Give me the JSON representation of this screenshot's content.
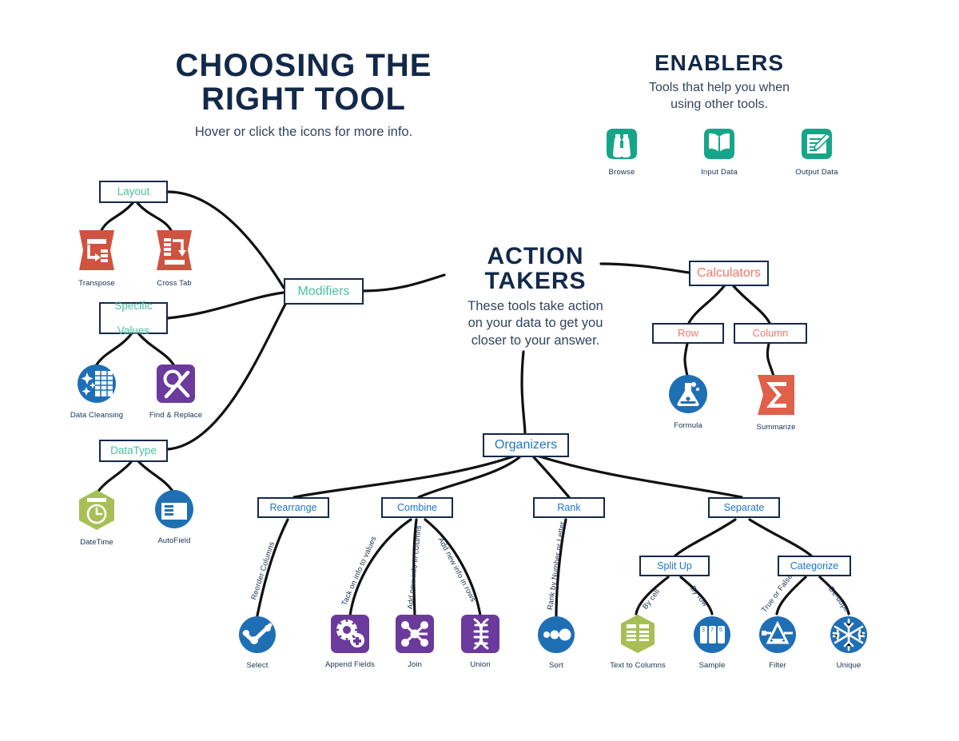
{
  "title": {
    "heading_line1": "CHOOSING THE",
    "heading_line2": "RIGHT TOOL",
    "subtitle": "Hover or click the icons for more info."
  },
  "enablers": {
    "heading": "ENABLERS",
    "subtitle_line1": "Tools that help you when",
    "subtitle_line2": "using other tools.",
    "items": [
      {
        "label": "Browse",
        "icon": "binoculars-icon",
        "color": "#17a589"
      },
      {
        "label": "Input Data",
        "icon": "open-book-icon",
        "color": "#17a589"
      },
      {
        "label": "Output Data",
        "icon": "document-pencil-icon",
        "color": "#17a589"
      }
    ]
  },
  "action_takers": {
    "heading_line1": "ACTION",
    "heading_line2": "TAKERS",
    "subtitle_line1": "These tools take action",
    "subtitle_line2": "on your data to get you",
    "subtitle_line3": "closer to your answer."
  },
  "nodes": {
    "modifiers": "Modifiers",
    "layout": "Layout",
    "specific_values_line1": "Specific",
    "specific_values_line2": "Values",
    "datatype": "DataType",
    "calculators": "Calculators",
    "row": "Row",
    "column": "Column",
    "organizers": "Organizers",
    "rearrange": "Rearrange",
    "combine": "Combine",
    "rank": "Rank",
    "separate": "Separate",
    "split_up": "Split Up",
    "categorize": "Categorize"
  },
  "edge_labels": {
    "reorder_columns": "Reorder Columns",
    "tack_on_info": "Tack on info to values",
    "add_info_columns": "Add new info in columns",
    "add_info_rows": "Add new info in rows",
    "rank_by": "Rank by Number or Letter",
    "by_cell": "By cell",
    "by_row": "By row",
    "true_or_false": "True or False",
    "de_dupe": "De-dupe"
  },
  "tools": [
    {
      "label": "Transpose",
      "icon": "transpose-icon",
      "color": "#cf5340",
      "shape": "wave"
    },
    {
      "label": "Cross Tab",
      "icon": "cross-tab-icon",
      "color": "#cf5340",
      "shape": "wave"
    },
    {
      "label": "Data Cleansing",
      "icon": "data-cleansing-icon",
      "color": "#1f6fb5",
      "shape": "circle"
    },
    {
      "label": "Find & Replace",
      "icon": "find-replace-icon",
      "color": "#6b3a9c",
      "shape": "square"
    },
    {
      "label": "DateTime",
      "icon": "datetime-icon",
      "color": "#a8bf56",
      "shape": "hexagon"
    },
    {
      "label": "AutoField",
      "icon": "autofield-icon",
      "color": "#1f6fb5",
      "shape": "circle"
    },
    {
      "label": "Formula",
      "icon": "formula-flask-icon",
      "color": "#1f6fb5",
      "shape": "circle"
    },
    {
      "label": "Summarize",
      "icon": "summarize-sigma-icon",
      "color": "#e0604a",
      "shape": "square"
    },
    {
      "label": "Select",
      "icon": "select-icon",
      "color": "#1f6fb5",
      "shape": "circle"
    },
    {
      "label": "Append Fields",
      "icon": "append-fields-icon",
      "color": "#6b3a9c",
      "shape": "square"
    },
    {
      "label": "Join",
      "icon": "join-icon",
      "color": "#6b3a9c",
      "shape": "square"
    },
    {
      "label": "Union",
      "icon": "union-dna-icon",
      "color": "#6b3a9c",
      "shape": "square"
    },
    {
      "label": "Sort",
      "icon": "sort-icon",
      "color": "#1f6fb5",
      "shape": "circle"
    },
    {
      "label": "Text to Columns",
      "icon": "text-to-columns-icon",
      "color": "#a8bf56",
      "shape": "hexagon"
    },
    {
      "label": "Sample",
      "icon": "sample-icon",
      "color": "#1f6fb5",
      "shape": "circle"
    },
    {
      "label": "Filter",
      "icon": "filter-icon",
      "color": "#1f6fb5",
      "shape": "circle"
    },
    {
      "label": "Unique",
      "icon": "unique-snowflake-icon",
      "color": "#1f6fb5",
      "shape": "circle"
    }
  ],
  "colors": {
    "navy": "#13294b",
    "teal": "#17a589",
    "mint": "#49c0a2",
    "salmon": "#f2766b",
    "blue": "#1f77c4",
    "purple": "#6b3a9c",
    "olive": "#a8bf56",
    "terracotta": "#cf5340"
  }
}
